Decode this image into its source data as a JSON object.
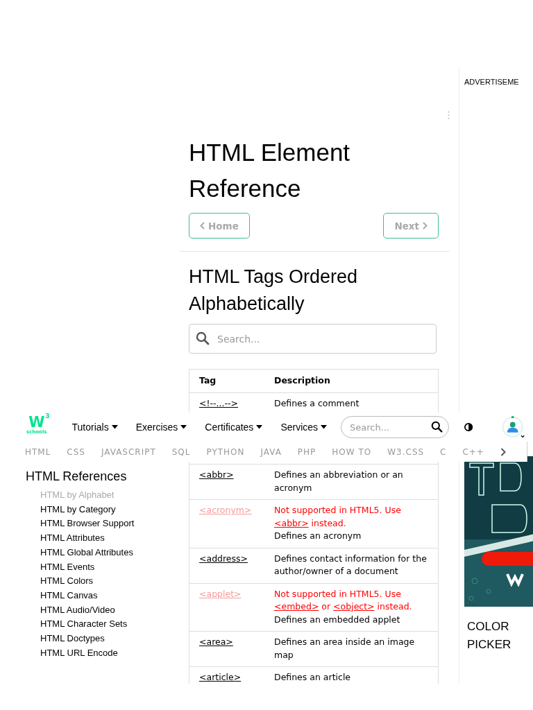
{
  "main": {
    "title": "HTML Element Reference",
    "nav_buttons": [
      {
        "label": "Home",
        "kind": "prev"
      },
      {
        "label": "Next",
        "kind": "next"
      }
    ],
    "subtitle": "HTML Tags Ordered Alphabetically",
    "search": {
      "placeholder": "Search..."
    },
    "table": {
      "columns": [
        "Tag",
        "Description"
      ],
      "rows": [
        {
          "tag": "<!--...-->",
          "deprecated": false,
          "description": "Defines a comment"
        },
        {
          "tag": "<abbr>",
          "deprecated": false,
          "description": "Defines an abbreviation or an acronym"
        },
        {
          "tag": "<acronym>",
          "deprecated": true,
          "notice": [
            {
              "text": "Not supported in HTML5. Use ",
              "link": false
            },
            {
              "text": "<abbr>",
              "link": true
            },
            {
              "text": " instead.",
              "link": false
            }
          ],
          "description": "Defines an acronym"
        },
        {
          "tag": "<address>",
          "deprecated": false,
          "description": "Defines contact information for the author/owner of a document"
        },
        {
          "tag": "<applet>",
          "deprecated": true,
          "notice": [
            {
              "text": "Not supported in HTML5. Use ",
              "link": false
            },
            {
              "text": "<embed>",
              "link": true
            },
            {
              "text": " or ",
              "link": false
            },
            {
              "text": "<object>",
              "link": true
            },
            {
              "text": " instead.",
              "link": false
            }
          ],
          "description": "Defines an embedded applet"
        },
        {
          "tag": "<area>",
          "deprecated": false,
          "description": "Defines an area inside an image map"
        },
        {
          "tag": "<article>",
          "deprecated": false,
          "description": "Defines an article"
        }
      ]
    }
  },
  "aside": {
    "ad_label": "ADVERTISEME",
    "color_picker": "COLOR PICKER"
  },
  "sidebar": {
    "title": "HTML References",
    "items": [
      {
        "label": "HTML by Alphabet",
        "selected": true
      },
      {
        "label": "HTML by Category",
        "selected": false
      },
      {
        "label": "HTML Browser Support",
        "selected": false
      },
      {
        "label": "HTML Attributes",
        "selected": false
      },
      {
        "label": "HTML Global Attributes",
        "selected": false
      },
      {
        "label": "HTML Events",
        "selected": false
      },
      {
        "label": "HTML Colors",
        "selected": false
      },
      {
        "label": "HTML Canvas",
        "selected": false
      },
      {
        "label": "HTML Audio/Video",
        "selected": false
      },
      {
        "label": "HTML Character Sets",
        "selected": false
      },
      {
        "label": "HTML Doctypes",
        "selected": false
      },
      {
        "label": "HTML URL Encode",
        "selected": false
      }
    ]
  },
  "header": {
    "logo": {
      "mark": "W",
      "superscript": "3",
      "wordmark": "schools"
    },
    "menus": [
      "Tutorials",
      "Exercises",
      "Certificates",
      "Services"
    ],
    "search": {
      "placeholder": "Search..."
    },
    "subnav": [
      "HTML",
      "CSS",
      "JAVASCRIPT",
      "SQL",
      "PYTHON",
      "JAVA",
      "PHP",
      "HOW TO",
      "W3.CSS",
      "C",
      "C++"
    ]
  }
}
